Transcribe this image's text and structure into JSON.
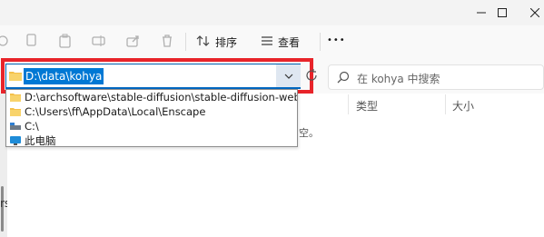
{
  "toolbar": {
    "sort_label": "排序",
    "view_label": "查看",
    "more_label": "•••"
  },
  "address": {
    "path": "D:\\data\\kohya"
  },
  "search": {
    "placeholder": "在 kohya 中搜索"
  },
  "columns": {
    "type": "类型",
    "size": "大小"
  },
  "dropdown": {
    "items": [
      {
        "label": "D:\\archsoftware\\stable-diffusion\\stable-diffusion-webui\\extensions\\",
        "icon": "folder-icon"
      },
      {
        "label": "C:\\Users\\ff\\AppData\\Local\\Enscape",
        "icon": "folder-icon"
      },
      {
        "label": "C:\\",
        "icon": "drive-icon"
      },
      {
        "label": "此电脑",
        "icon": "computer-icon"
      }
    ]
  },
  "content": {
    "empty_hint_fragment": "空。"
  },
  "sidebar": {
    "partial_label": "rs"
  },
  "colors": {
    "accent": "#0078d4",
    "highlight_box": "#e8242a",
    "folder": "#f4c04a"
  }
}
